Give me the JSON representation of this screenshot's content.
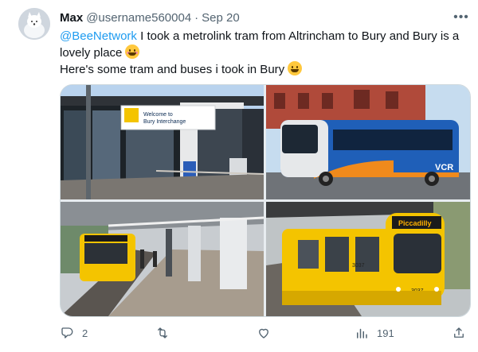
{
  "tweet": {
    "display_name": "Max",
    "handle": "@username560004",
    "separator": "·",
    "date": "Sep 20",
    "more_label": "•••",
    "text": {
      "mention": "@BeeNetwork",
      "line1": " I took a metrolink tram from Altrincham to Bury and Bury is a lovely place",
      "line2": "Here's some tram and buses i took in Bury"
    },
    "media": {
      "sign_line1": "Welcome to",
      "sign_line2": "Bury Interchange",
      "bus_route_label": "VCR",
      "tram_destination": "Piccadilly",
      "tram_number_1": "3037",
      "tram_number_2": "3037"
    },
    "actions": {
      "reply_count": "2",
      "retweet_count": "",
      "like_count": "",
      "views_count": "191"
    }
  },
  "colors": {
    "accent": "#1d9bf0",
    "text_primary": "#0f1419",
    "text_secondary": "#536471",
    "border": "#cfd9de",
    "tram_yellow": "#f4c400",
    "bus_blue": "#1f5fb8"
  }
}
